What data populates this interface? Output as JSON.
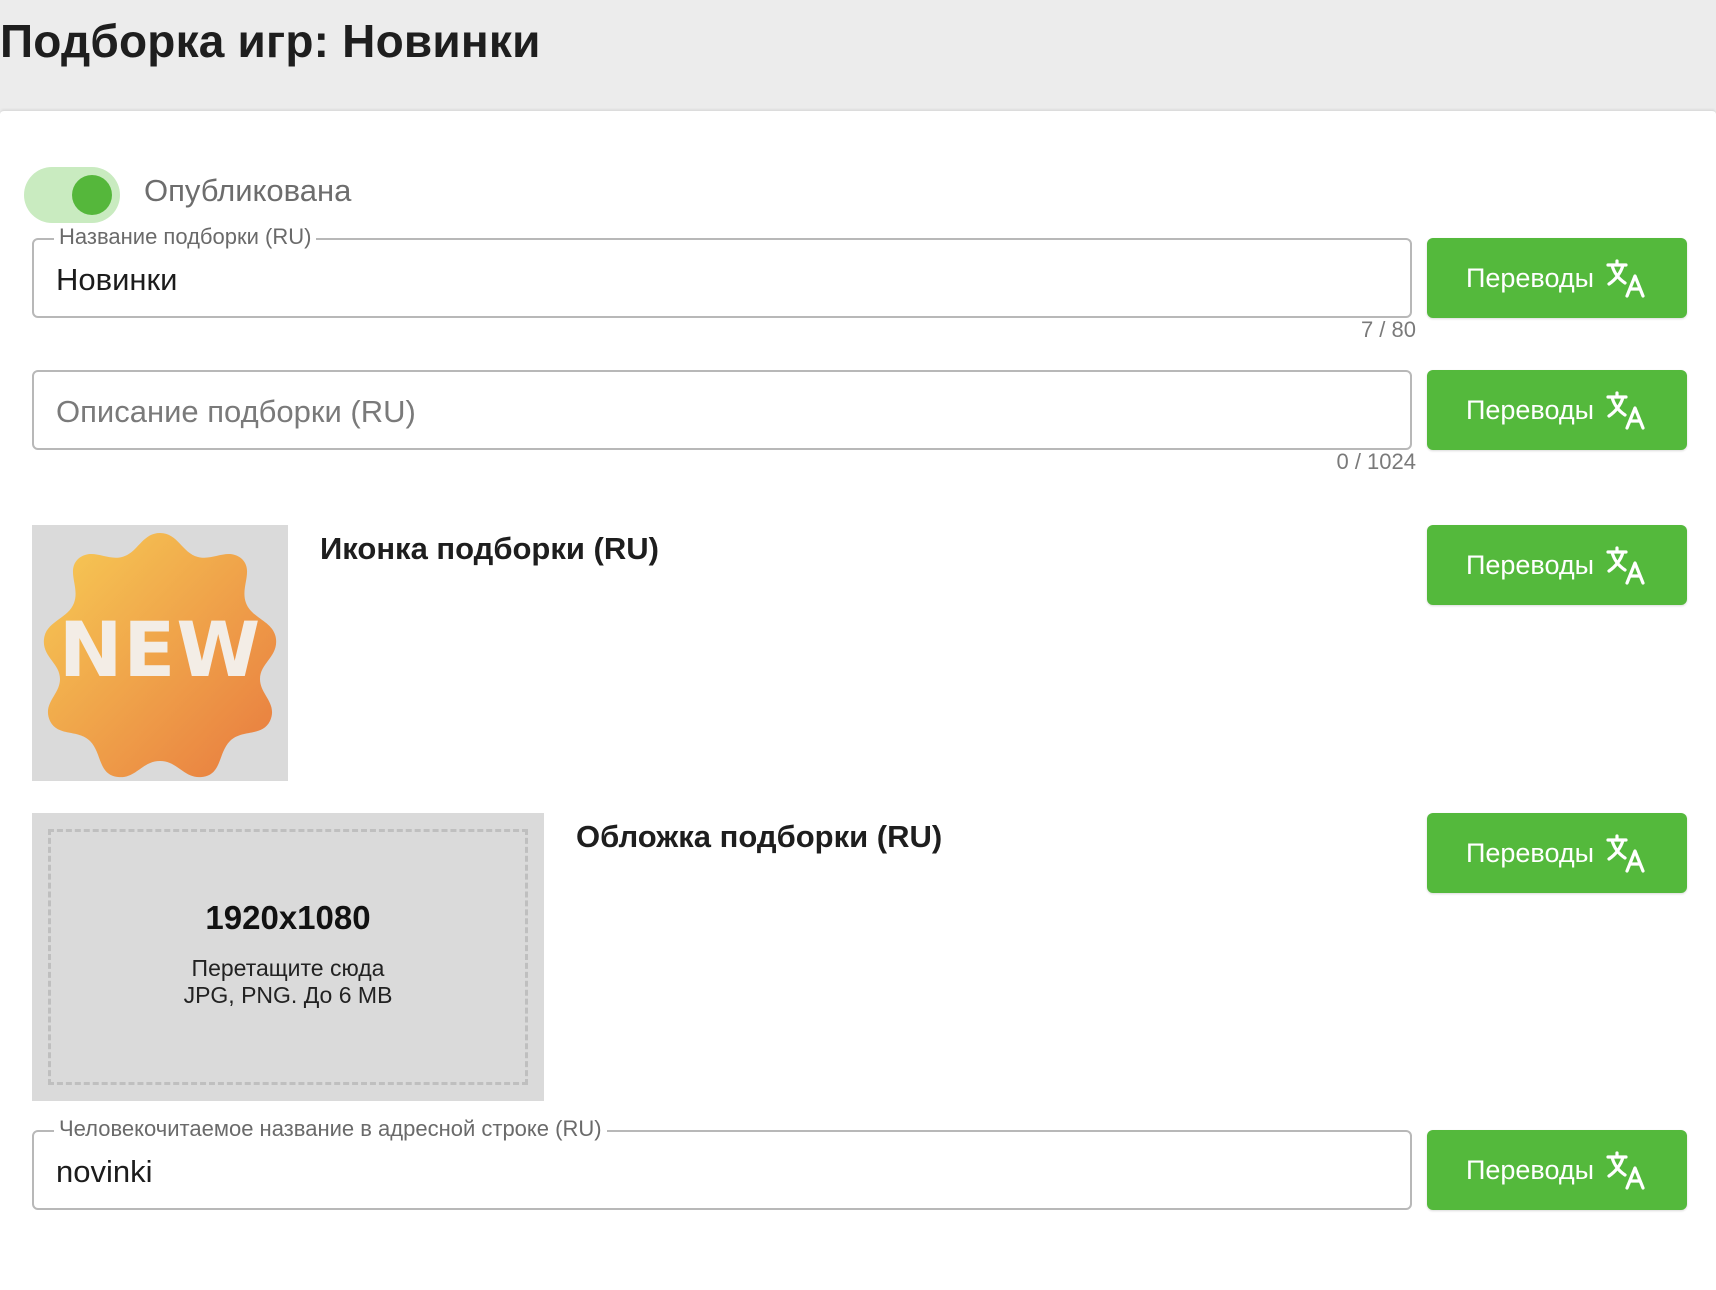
{
  "header": {
    "title": "Подборка игр: Новинки"
  },
  "status": {
    "published_label": "Опубликована",
    "published": true
  },
  "fields": {
    "name": {
      "legend": "Название подборки (RU)",
      "value": "Новинки",
      "counter": "7 / 80"
    },
    "description": {
      "placeholder": "Описание подборки (RU)",
      "value": "",
      "counter": "0 / 1024"
    },
    "slug": {
      "legend": "Человекочитаемое название в адресной строке (RU)",
      "value": "novinki"
    }
  },
  "icon_section": {
    "title": "Иконка подборки (RU)",
    "image_text": "NEW"
  },
  "cover_section": {
    "title": "Обложка подборки (RU)",
    "resolution": "1920x1080",
    "hint_line1": "Перетащите сюда",
    "hint_line2": "JPG, PNG. До 6 MB"
  },
  "buttons": {
    "translations_label": "Переводы",
    "icon": "translate-icon"
  },
  "colors": {
    "accent": "#54b93c",
    "toggle_track": "#c9ebc0",
    "header_bg": "#ececec"
  }
}
